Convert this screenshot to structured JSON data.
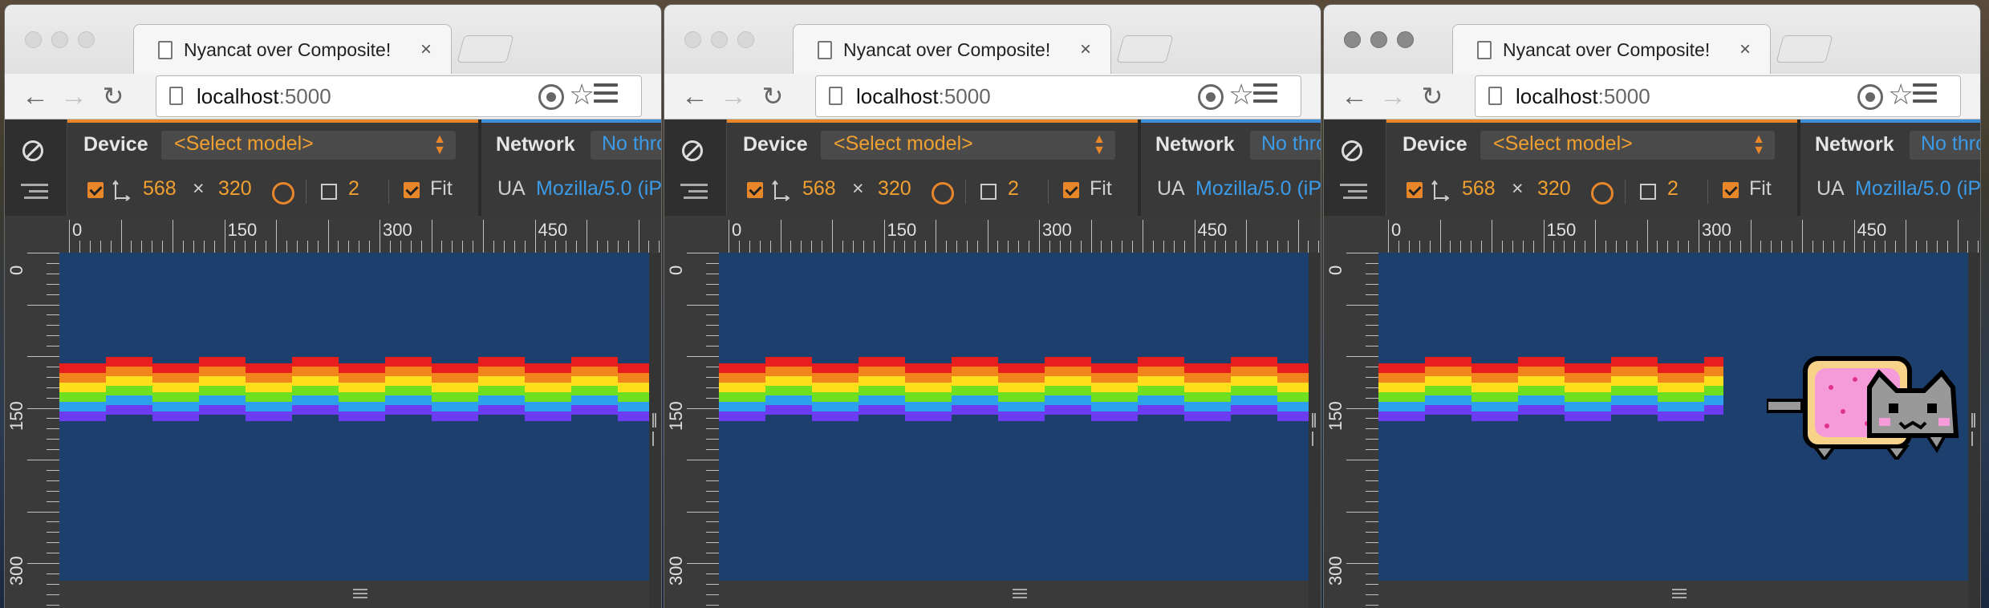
{
  "tab": {
    "title": "Nyancat over Composite!",
    "close_glyph": "×"
  },
  "omnibox": {
    "host": "localhost",
    "port": ":5000"
  },
  "devtools": {
    "device_label": "Device",
    "model_select": "<Select model>",
    "network_label": "Network",
    "throttle_value": "No thro",
    "width": "568",
    "times": "×",
    "height": "320",
    "dpr": "2",
    "fit_label": "Fit",
    "ua_label": "UA",
    "ua_value": "Mozilla/5.0 (iP"
  },
  "ruler": {
    "h_labels": [
      "0",
      "150",
      "300",
      "450"
    ],
    "v_labels": [
      "0",
      "150",
      "300"
    ]
  },
  "panels": [
    {
      "state": "inactive",
      "show_cat": false
    },
    {
      "state": "inactive",
      "show_cat": false
    },
    {
      "state": "active",
      "show_cat": true
    }
  ],
  "colors": {
    "rainbow": [
      "#e81d1d",
      "#f2841c",
      "#ffde1b",
      "#6ee01f",
      "#2ea1ec",
      "#6b3cf0"
    ],
    "canvas": "#1c3f6e",
    "accent": "#e8862a",
    "link": "#3b9be8"
  },
  "icons": [
    "back-icon",
    "forward-icon",
    "reload-icon",
    "page-icon",
    "location-icon",
    "star-icon",
    "menu-icon",
    "block-icon",
    "device-mode-icon",
    "resolution-icon",
    "rotate-icon",
    "dpr-icon",
    "resize-grip-icon"
  ]
}
